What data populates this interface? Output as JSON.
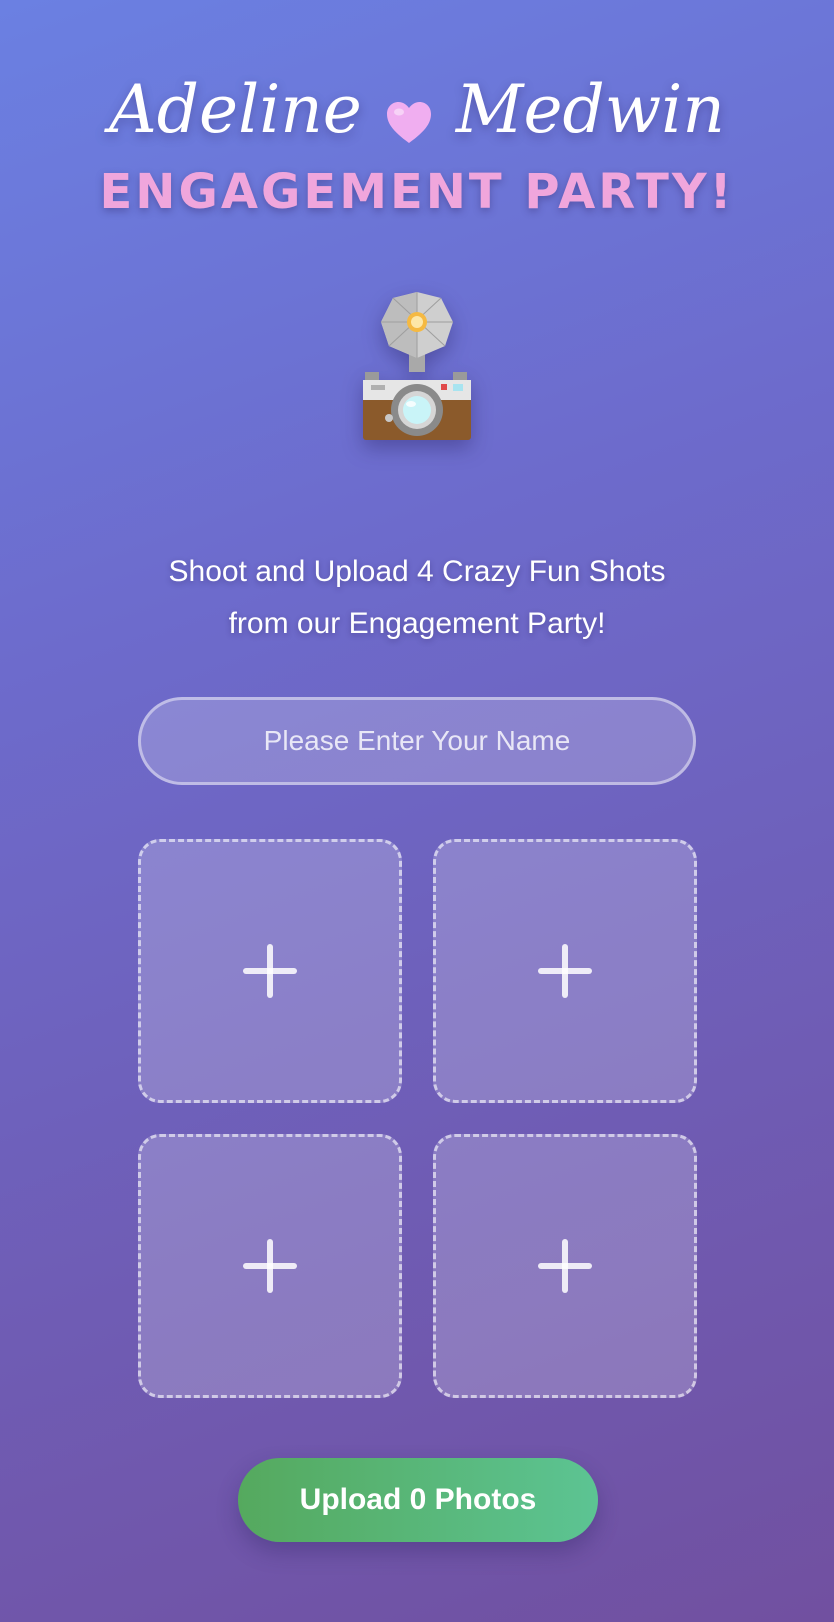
{
  "header": {
    "name_left": "Adeline",
    "name_right": "Medwin",
    "heart_icon": "heart-icon",
    "subtitle": "ENGAGEMENT PARTY!"
  },
  "hero": {
    "icon": "flash-camera-icon"
  },
  "instructions": {
    "line1": "Shoot and Upload 4 Crazy Fun Shots",
    "line2": "from our Engagement Party!"
  },
  "name_field": {
    "placeholder": "Please Enter Your Name",
    "value": ""
  },
  "photo_slots": [
    {
      "icon": "plus-icon"
    },
    {
      "icon": "plus-icon"
    },
    {
      "icon": "plus-icon"
    },
    {
      "icon": "plus-icon"
    }
  ],
  "upload_button": {
    "label": "Upload 0 Photos"
  },
  "colors": {
    "subtitle": "#f0a6dc",
    "heart": "#f0aef0",
    "button_start": "#55a95e",
    "button_end": "#5cc493"
  }
}
